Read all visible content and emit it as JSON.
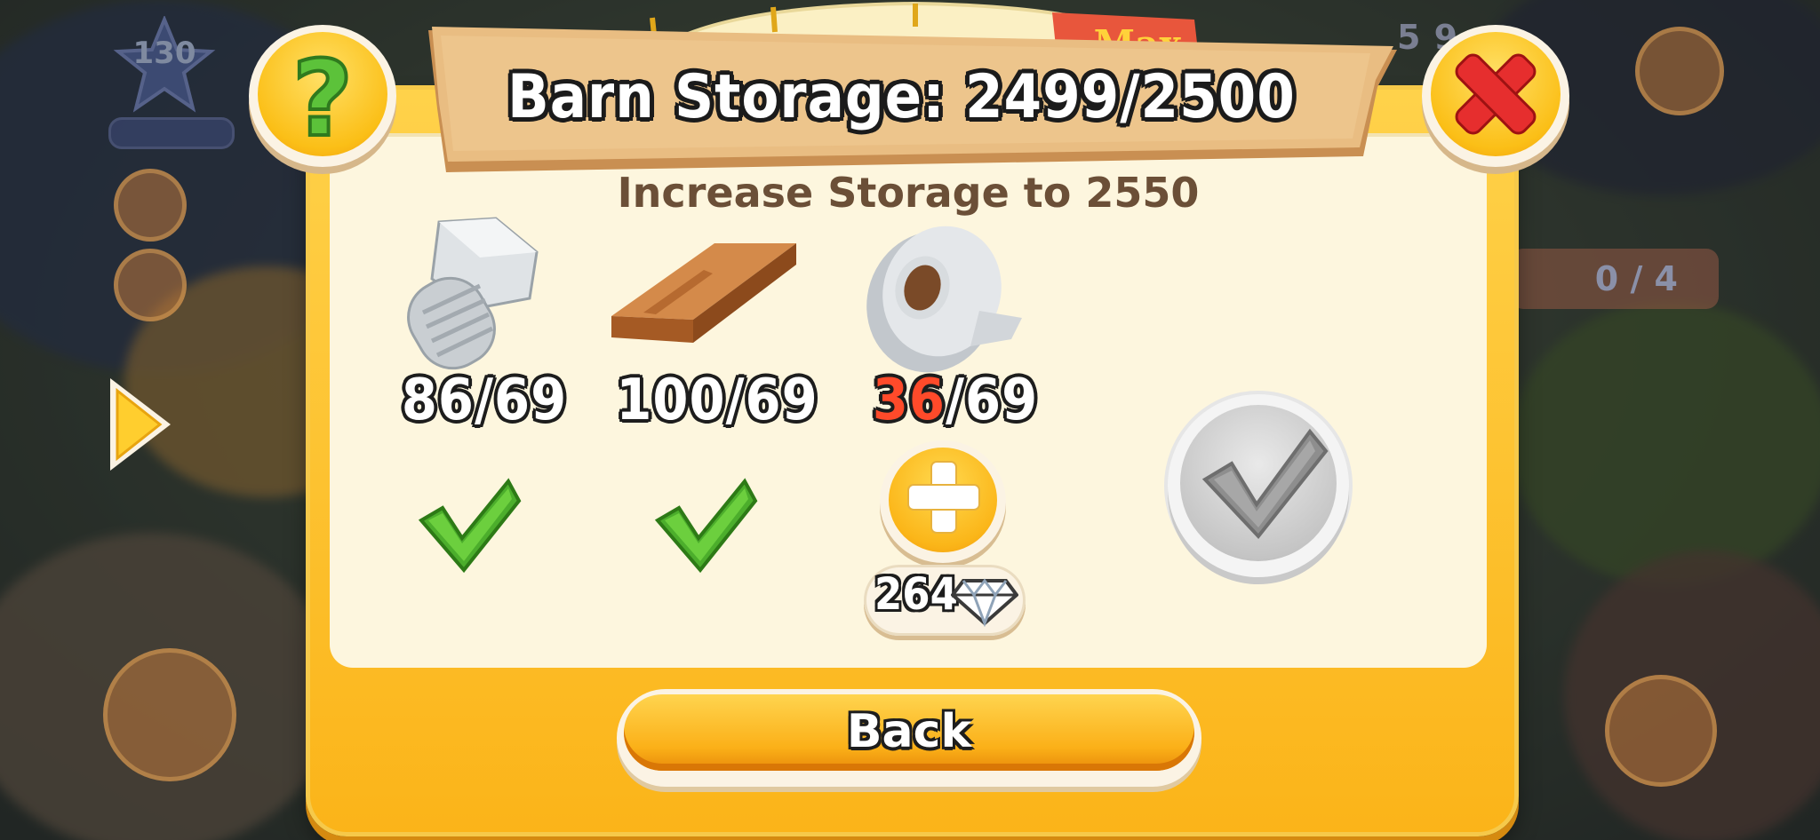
{
  "hud": {
    "level": "130",
    "coins": "5 9",
    "order_counter": "0 / 4"
  },
  "dialog": {
    "title": "Barn Storage: 2499/2500",
    "subtitle": "Increase Storage to 2550",
    "dial_label": "Max",
    "resources": [
      {
        "name": "bolt-icon",
        "have": "86",
        "need": "69",
        "sufficient": true
      },
      {
        "name": "plank-icon",
        "have": "100",
        "need": "69",
        "sufficient": true
      },
      {
        "name": "duct-tape-icon",
        "have": "36",
        "need": "69",
        "sufficient": false
      }
    ],
    "buy_missing_price": "264",
    "back_label": "Back"
  },
  "colors": {
    "panel": "#fbb419",
    "inner": "#fdf6de",
    "shortfall": "#ff4a2a",
    "check_green": "#4cae2c"
  }
}
